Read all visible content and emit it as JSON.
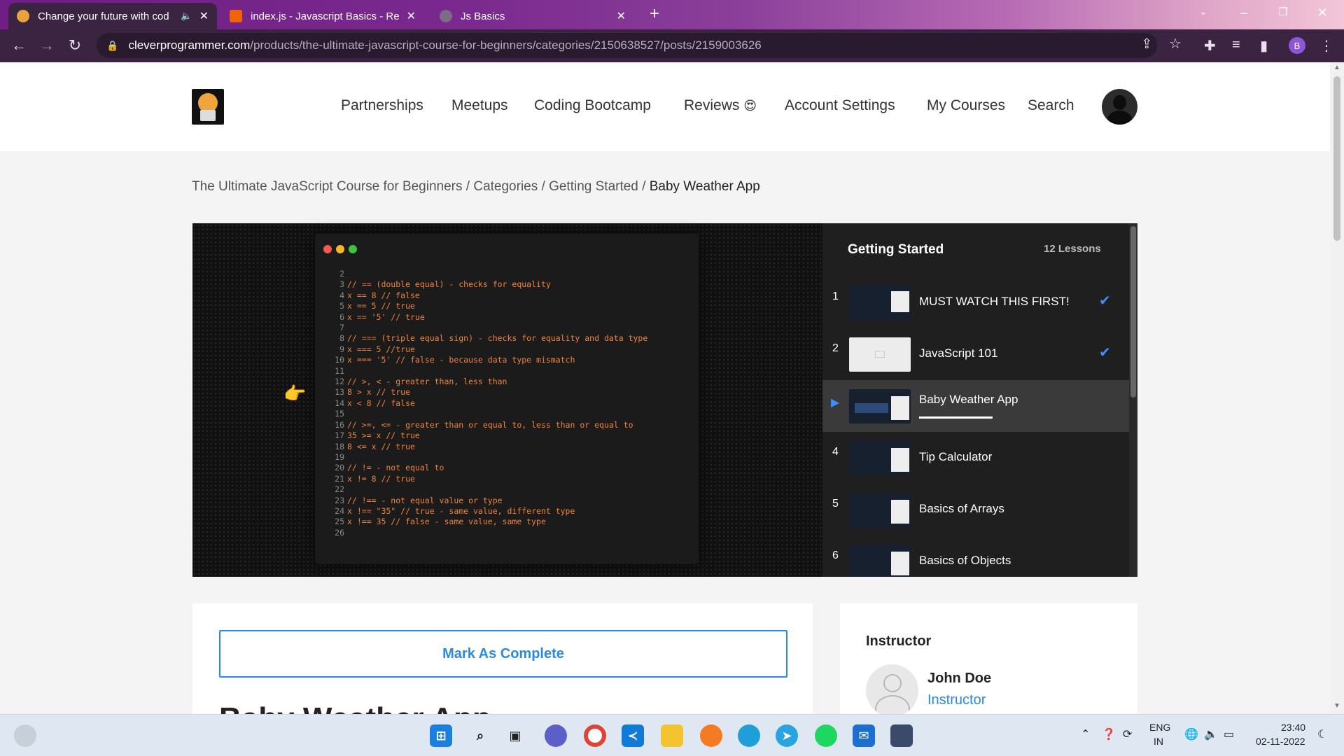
{
  "browser": {
    "tabs": [
      {
        "title": "Change your future with cod",
        "active": true,
        "audio": true
      },
      {
        "title": "index.js - Javascript Basics - Repli",
        "active": false
      },
      {
        "title": "Js Basics",
        "active": false
      }
    ],
    "new_tab_icon": "plus-icon",
    "url_host": "cleverprogrammer.com",
    "url_path": "/products/the-ultimate-javascript-course-for-beginners/categories/2150638527/posts/2159003626",
    "profile_initial": "B"
  },
  "site": {
    "nav": [
      "Partnerships",
      "Meetups",
      "Coding Bootcamp",
      "Reviews",
      "Account Settings",
      "My Courses",
      "Search"
    ],
    "reviews_emoji": "😍"
  },
  "breadcrumb": {
    "course": "The Ultimate JavaScript Course for Beginners",
    "sep": " / ",
    "categories": "Categories",
    "section": "Getting Started",
    "current": "Baby Weather App"
  },
  "video": {
    "code_lines": [
      {
        "n": "2",
        "t": ""
      },
      {
        "n": "3",
        "t": "// == (double equal) - checks for equality"
      },
      {
        "n": "4",
        "t": "x == 8 // false"
      },
      {
        "n": "5",
        "t": "x == 5 // true"
      },
      {
        "n": "6",
        "t": "x == '5' // true"
      },
      {
        "n": "7",
        "t": ""
      },
      {
        "n": "8",
        "t": "// === (triple equal sign) - checks for equality and data type"
      },
      {
        "n": "9",
        "t": "x === 5 //true"
      },
      {
        "n": "10",
        "t": "x === '5' // false - because data type mismatch"
      },
      {
        "n": "11",
        "t": ""
      },
      {
        "n": "12",
        "t": "// >, < - greater than, less than"
      },
      {
        "n": "13",
        "t": "8 > x // true"
      },
      {
        "n": "14",
        "t": "x < 8 // false"
      },
      {
        "n": "15",
        "t": ""
      },
      {
        "n": "16",
        "t": "// >=, <= - greater than or equal to, less than or equal to"
      },
      {
        "n": "17",
        "t": "35 >= x // true"
      },
      {
        "n": "18",
        "t": "8 <= x // true"
      },
      {
        "n": "19",
        "t": ""
      },
      {
        "n": "20",
        "t": "// != - not equal to"
      },
      {
        "n": "21",
        "t": "x != 8 // true"
      },
      {
        "n": "22",
        "t": ""
      },
      {
        "n": "23",
        "t": "// !== - not equal value or type"
      },
      {
        "n": "24",
        "t": "x !== \"35\" // true - same value, different type"
      },
      {
        "n": "25",
        "t": "x !== 35 // false - same value, same type"
      },
      {
        "n": "26",
        "t": ""
      }
    ]
  },
  "lessons": {
    "title": "Getting Started",
    "count": "12 Lessons",
    "items": [
      {
        "num": "1",
        "name": "MUST WATCH THIS FIRST!",
        "done": true
      },
      {
        "num": "2",
        "name": "JavaScript 101",
        "done": true
      },
      {
        "num": "",
        "name": "Baby Weather App",
        "current": true,
        "progress": 0.55
      },
      {
        "num": "4",
        "name": "Tip Calculator"
      },
      {
        "num": "5",
        "name": "Basics of Arrays"
      },
      {
        "num": "6",
        "name": "Basics of Objects"
      }
    ]
  },
  "main": {
    "complete_label": "Mark As Complete",
    "heading": "Baby Weather App"
  },
  "instructor": {
    "title": "Instructor",
    "name": "John Doe",
    "role": "Instructor"
  },
  "taskbar": {
    "lang_top": "ENG",
    "lang_bottom": "IN",
    "time": "23:40",
    "date": "02-11-2022"
  },
  "colors": {
    "accent": "#2a8ae0",
    "check": "#3d8eff",
    "code": "#f0833a",
    "tab_active": "#3a2441"
  }
}
